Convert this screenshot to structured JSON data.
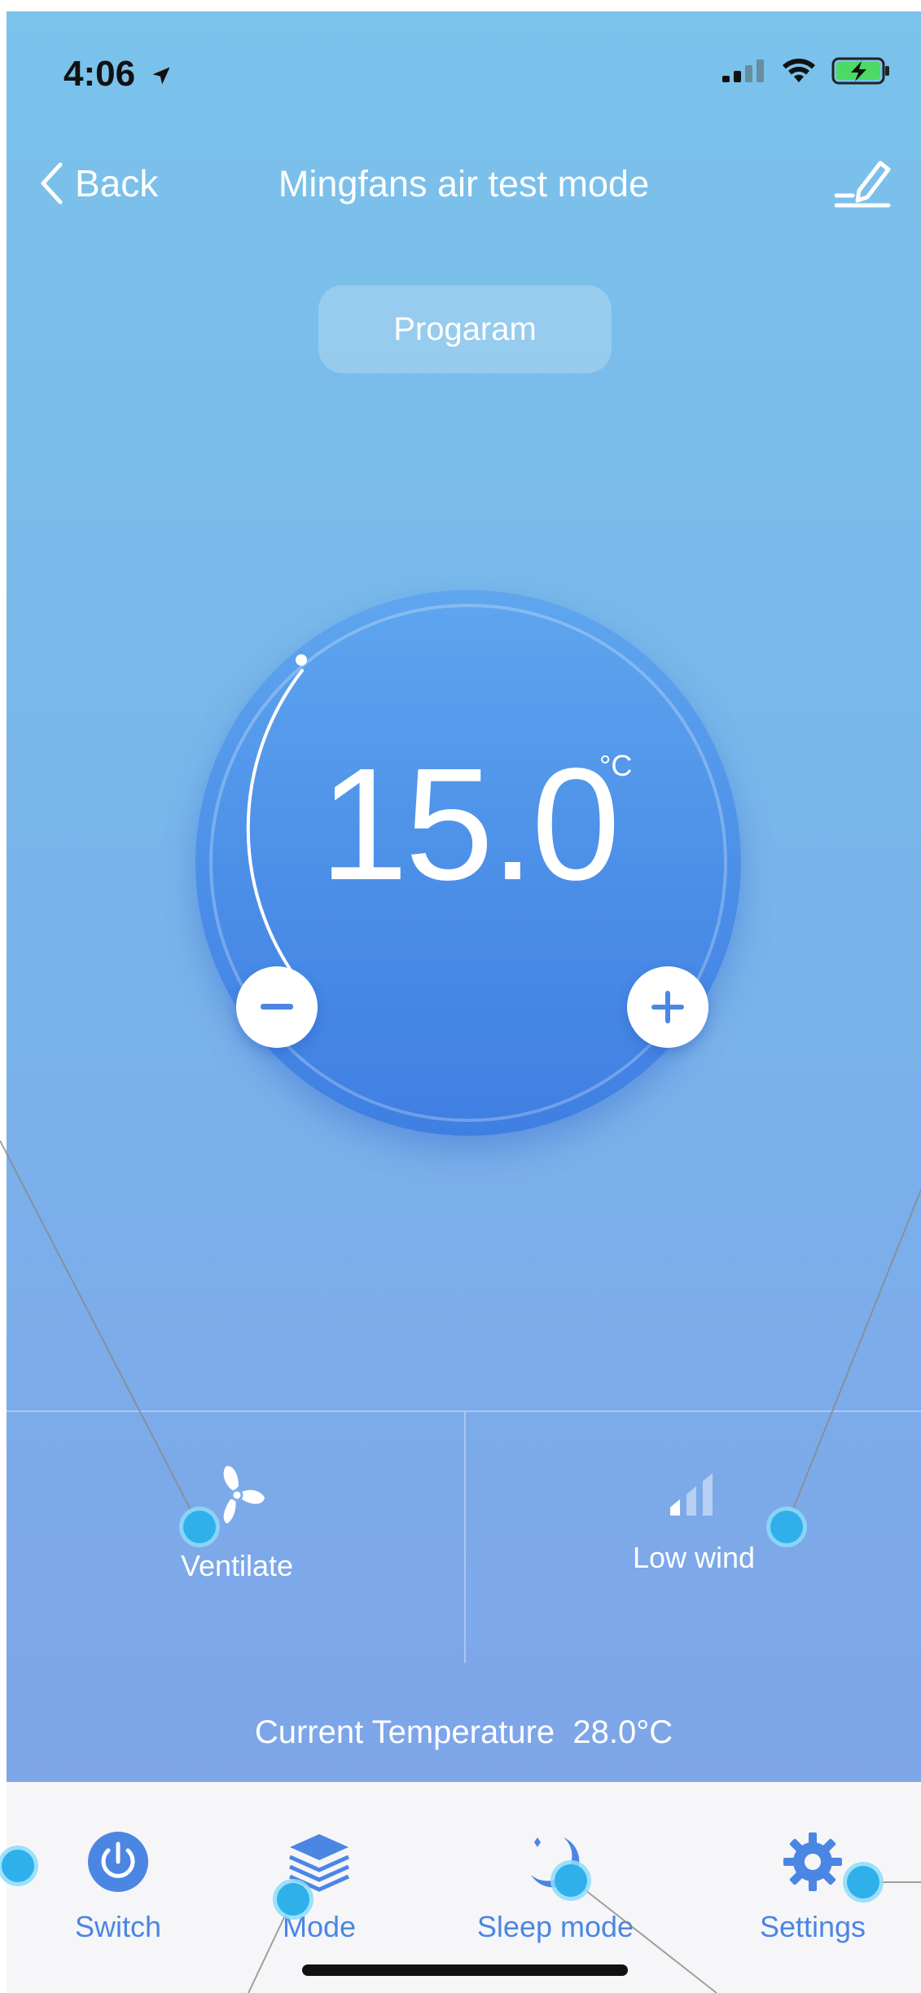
{
  "status_bar": {
    "time": "4:06"
  },
  "nav": {
    "back_label": "Back",
    "title": "Mingfans air test mode"
  },
  "program_button": "Progaram",
  "thermostat": {
    "set_temperature": "15.0",
    "unit": "°C"
  },
  "modes": [
    {
      "label": "Ventilate",
      "icon": "fan-icon"
    },
    {
      "label": "Low wind",
      "icon": "wind-level-icon"
    }
  ],
  "current_temperature": {
    "label": "Current Temperature",
    "value": "28.0°C"
  },
  "tabbar": [
    {
      "label": "Switch",
      "icon": "power-icon"
    },
    {
      "label": "Mode",
      "icon": "layers-icon"
    },
    {
      "label": "Sleep mode",
      "icon": "moon-icon"
    },
    {
      "label": "Settings",
      "icon": "gear-icon"
    }
  ],
  "colors": {
    "accent": "#4b86e3",
    "background_top": "#7ac3eb",
    "background_bottom": "#7ea3e9",
    "dial": "#4b8ee8"
  }
}
